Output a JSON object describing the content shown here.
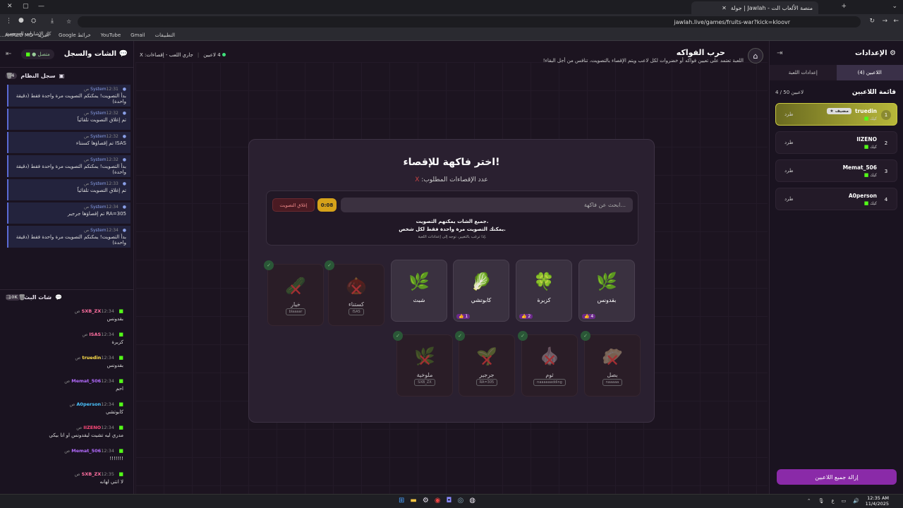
{
  "browser": {
    "tab_title": "جولة | Jawlah - منصة الألعاب الت",
    "url": "jawlah.live/games/fruits-war?kick=kloovr",
    "bookmarks": [
      "التطبيقات",
      "Gmail",
      "YouTube",
      "خرائط Google",
      "البريد - AHMED MO..."
    ],
    "bookmarks_left": "كل الإشارات المرجعية"
  },
  "left": {
    "title": "الشات والسجل",
    "status": "متصل",
    "system": {
      "title": "سجل النظام",
      "count": "34",
      "messages": [
        {
          "sender": "System",
          "time": "12:31 ص",
          "text": "بدأ التصويت! يمكنكم التصويت مرة واحدة فقط (دقيقة واحدة)"
        },
        {
          "sender": "System",
          "time": "12:32 ص",
          "text": "تم إغلاق التصويت تلقائياً"
        },
        {
          "sender": "System",
          "time": "12:32 ص",
          "text": "ISAS تم إقصاؤها كسنتاء"
        },
        {
          "sender": "System",
          "time": "12:32 ص",
          "text": "بدأ التصويت! يمكنكم التصويت مرة واحدة فقط (دقيقة واحدة)"
        },
        {
          "sender": "System",
          "time": "12:33 ص",
          "text": "تم إغلاق التصويت تلقائياً"
        },
        {
          "sender": "System",
          "time": "12:34 ص",
          "text": "RA=305 تم إقصاؤها جرجير"
        },
        {
          "sender": "System",
          "time": "12:34 ص",
          "text": "بدأ التصويت! يمكنكم التصويت مرة واحدة فقط (دقيقة واحدة)"
        }
      ]
    },
    "chat": {
      "title": "شات البث",
      "count": "10K",
      "messages": [
        {
          "user": "SXB_ZX",
          "color": "#ff6fa0",
          "time": "12:34 ص",
          "text": "بقدونس"
        },
        {
          "user": "ISAS",
          "color": "#ff6fa0",
          "time": "12:34 ص",
          "text": "كزبرة"
        },
        {
          "user": "truedin",
          "color": "#ffe04a",
          "time": "12:34 ص",
          "text": "بقدونس"
        },
        {
          "user": "Memat_506",
          "color": "#b36bff",
          "time": "12:34 ص",
          "text": "احم"
        },
        {
          "user": "A0person",
          "color": "#4ac4ff",
          "time": "12:34 ص",
          "text": "كابوتشي"
        },
        {
          "user": "IIZENO",
          "color": "#ff4a7a",
          "time": "12:34 ص",
          "text": "مدري ليه تشيت ليقدونس او انا بيكي"
        },
        {
          "user": "Memat_506",
          "color": "#b36bff",
          "time": "12:34 ص",
          "text": "!!!!!!!"
        },
        {
          "user": "SXB_ZX",
          "color": "#ff6fa0",
          "time": "12:35 ص",
          "text": "لا انتي لهانه"
        }
      ]
    }
  },
  "header": {
    "title": "حرب الفواكه",
    "subtitle": "اللعبة تعتمد على تعيين فواكه أو خضروات لكل لاعب ويتم الإقصاء بالتصويت، تنافس من أجل البقاء!",
    "players_live": "4 لاعبين",
    "state": "جاري اللعب - إقصاءات: X"
  },
  "modal": {
    "title": "اختر فاكهة للإقصاء!",
    "subtitle": "عدد الإقصاءات المطلوب:",
    "subtitle_x": "X",
    "search_placeholder": "ابحث عن فاكهة...",
    "timer": "0:08",
    "close_vote": "إغلاق التصويت",
    "note1": "جميع الشات يمكنهم التصويت.",
    "note2": "يمكنك التصويت مرة واحدة فقط لكل شخص.",
    "note3": "إذا ترغب بالتغيير، توجه إلى إعدادات اللعبة.",
    "active": [
      {
        "name": "بقدونس",
        "emoji": "🌿",
        "votes": "4"
      },
      {
        "name": "كزبرة",
        "emoji": "🍀",
        "votes": "2"
      },
      {
        "name": "كابوتشي",
        "emoji": "🥬",
        "votes": "1"
      },
      {
        "name": "شبث",
        "emoji": "🌿",
        "votes": ""
      }
    ],
    "eliminated_top": [
      {
        "name": "كستناء",
        "emoji": "🌰",
        "owner": "ISAS"
      },
      {
        "name": "خيار",
        "emoji": "🥒",
        "owner": "blaaaar"
      }
    ],
    "eliminated_bottom": [
      {
        "name": "بصل",
        "emoji": "🥟",
        "owner": "naaaaa"
      },
      {
        "name": "ثوم",
        "emoji": "🧄",
        "owner": "naaaaaadding"
      },
      {
        "name": "جرجير",
        "emoji": "🌱",
        "owner": "RA=305"
      },
      {
        "name": "ملوخية",
        "emoji": "🌿",
        "owner": "SXB_ZX"
      }
    ]
  },
  "right": {
    "title": "الإعدادات",
    "tabs": [
      "اللاعبين (4)",
      "إعدادات اللعبة"
    ],
    "list_title": "قائمة اللاعبين",
    "list_count": "4 / 50 لاعبين",
    "kick_label": "طرد",
    "host_badge": "★ مضيف",
    "players": [
      {
        "rank": "1",
        "name": "truedin",
        "platform": "كيك",
        "host": true
      },
      {
        "rank": "2",
        "name": "IIZENO",
        "platform": "كيك",
        "host": false
      },
      {
        "rank": "3",
        "name": "Memat_506",
        "platform": "كيك",
        "host": false
      },
      {
        "rank": "4",
        "name": "A0person",
        "platform": "كيك",
        "host": false
      }
    ],
    "remove_all": "إزالة جميع اللاعبين"
  },
  "taskbar": {
    "time": "12:35 AM",
    "date": "11/4/2025",
    "lang": "ع"
  }
}
